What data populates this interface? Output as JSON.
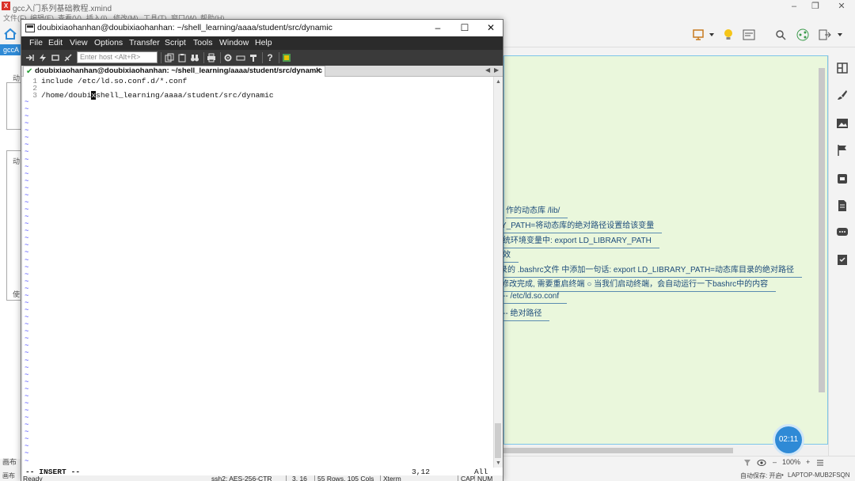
{
  "xmind": {
    "title": "gcc入门系列基础教程.xmind",
    "menu": [
      "文件(F)",
      "编辑(E)",
      "查看(V)",
      "插入(I)",
      "修改(M)",
      "工具(T)",
      "窗口(W)",
      "帮助(H)"
    ],
    "tab_label": "gccA",
    "left_fragments": [
      "动",
      "动",
      "使"
    ],
    "nodes": [
      "作的动态库 /lib/",
      "Y_PATH=将动态库的绝对路径设置给该变量",
      "统环境变量中: export LD_LIBRARY_PATH",
      "效",
      "录的 .bashrc文件 中添加一句话: export LD_LIBRARY_PATH=动态库目录的绝对路径",
      "修改完成, 需要重启终端  ○   当我们启动终端，会自动运行一下bashrc中的内容",
      "--  /etc/ld.so.conf",
      "-- 绝对路径"
    ],
    "timer": "02:11",
    "zoom": "100%",
    "layout_label": "画布",
    "status_left": "画布",
    "autosave": "自动保存: 开启",
    "machine": "LAPTOP-MUB2FSQN"
  },
  "crt": {
    "window_title": "doubixiaohanhan@doubixiaohanhan: ~/shell_learning/aaaa/student/src/dynamic",
    "menu": [
      "File",
      "Edit",
      "View",
      "Options",
      "Transfer",
      "Script",
      "Tools",
      "Window",
      "Help"
    ],
    "host_placeholder": "Enter host <Alt+R>",
    "tab_title": "doubixiaohanhan@doubixiaohanhan: ~/shell_learning/aaaa/student/src/dynamic",
    "lines": [
      {
        "num": "1",
        "text": "include /etc/ld.so.conf.d/*.conf"
      },
      {
        "num": "2",
        "text": ""
      },
      {
        "num": "3",
        "text_before": "/home/doubi",
        "cursor": "x",
        "text_after": "shell_learning/aaaa/student/src/dynamic"
      }
    ],
    "tilde": "~",
    "mode": "-- INSERT --",
    "position": "3,12",
    "scope": "All",
    "status": {
      "ready": "Ready",
      "cipher": "ssh2: AES-256-CTR",
      "cursor": "3, 16",
      "size": "55 Rows, 105 Cols",
      "term": "Xterm",
      "cap": "CAP",
      "num": "NUM"
    }
  }
}
